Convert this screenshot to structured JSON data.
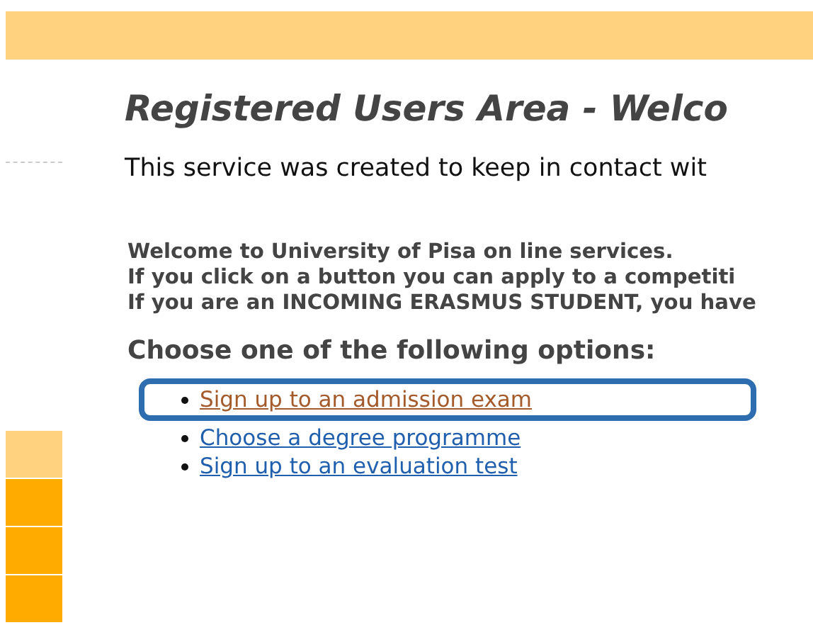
{
  "title": "Registered Users Area - Welco",
  "intro": "This service was created to keep in contact wit",
  "welcome_lines": [
    "Welcome to University of Pisa on line services.",
    "If you click on a button you can apply to a competiti",
    "If you are an INCOMING ERASMUS STUDENT, you have"
  ],
  "options_heading": "Choose one of the following options:",
  "options": [
    {
      "label": "Sign up to an admission exam",
      "highlighted": true
    },
    {
      "label": "Choose a degree programme",
      "highlighted": false
    },
    {
      "label": "Sign up to an evaluation test",
      "highlighted": false
    }
  ],
  "sidebar_blocks": [
    {
      "selected": true
    },
    {
      "selected": false
    },
    {
      "selected": false
    },
    {
      "selected": false
    }
  ]
}
